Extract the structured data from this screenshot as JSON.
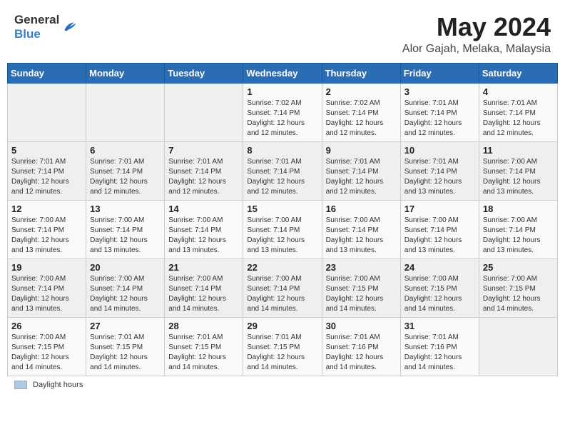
{
  "header": {
    "logo_line1": "General",
    "logo_line2": "Blue",
    "title": "May 2024",
    "subtitle": "Alor Gajah, Melaka, Malaysia"
  },
  "days_of_week": [
    "Sunday",
    "Monday",
    "Tuesday",
    "Wednesday",
    "Thursday",
    "Friday",
    "Saturday"
  ],
  "weeks": [
    {
      "days": [
        {
          "number": "",
          "info": ""
        },
        {
          "number": "",
          "info": ""
        },
        {
          "number": "",
          "info": ""
        },
        {
          "number": "1",
          "info": "Sunrise: 7:02 AM\nSunset: 7:14 PM\nDaylight: 12 hours\nand 12 minutes."
        },
        {
          "number": "2",
          "info": "Sunrise: 7:02 AM\nSunset: 7:14 PM\nDaylight: 12 hours\nand 12 minutes."
        },
        {
          "number": "3",
          "info": "Sunrise: 7:01 AM\nSunset: 7:14 PM\nDaylight: 12 hours\nand 12 minutes."
        },
        {
          "number": "4",
          "info": "Sunrise: 7:01 AM\nSunset: 7:14 PM\nDaylight: 12 hours\nand 12 minutes."
        }
      ]
    },
    {
      "days": [
        {
          "number": "5",
          "info": "Sunrise: 7:01 AM\nSunset: 7:14 PM\nDaylight: 12 hours\nand 12 minutes."
        },
        {
          "number": "6",
          "info": "Sunrise: 7:01 AM\nSunset: 7:14 PM\nDaylight: 12 hours\nand 12 minutes."
        },
        {
          "number": "7",
          "info": "Sunrise: 7:01 AM\nSunset: 7:14 PM\nDaylight: 12 hours\nand 12 minutes."
        },
        {
          "number": "8",
          "info": "Sunrise: 7:01 AM\nSunset: 7:14 PM\nDaylight: 12 hours\nand 12 minutes."
        },
        {
          "number": "9",
          "info": "Sunrise: 7:01 AM\nSunset: 7:14 PM\nDaylight: 12 hours\nand 12 minutes."
        },
        {
          "number": "10",
          "info": "Sunrise: 7:01 AM\nSunset: 7:14 PM\nDaylight: 12 hours\nand 13 minutes."
        },
        {
          "number": "11",
          "info": "Sunrise: 7:00 AM\nSunset: 7:14 PM\nDaylight: 12 hours\nand 13 minutes."
        }
      ]
    },
    {
      "days": [
        {
          "number": "12",
          "info": "Sunrise: 7:00 AM\nSunset: 7:14 PM\nDaylight: 12 hours\nand 13 minutes."
        },
        {
          "number": "13",
          "info": "Sunrise: 7:00 AM\nSunset: 7:14 PM\nDaylight: 12 hours\nand 13 minutes."
        },
        {
          "number": "14",
          "info": "Sunrise: 7:00 AM\nSunset: 7:14 PM\nDaylight: 12 hours\nand 13 minutes."
        },
        {
          "number": "15",
          "info": "Sunrise: 7:00 AM\nSunset: 7:14 PM\nDaylight: 12 hours\nand 13 minutes."
        },
        {
          "number": "16",
          "info": "Sunrise: 7:00 AM\nSunset: 7:14 PM\nDaylight: 12 hours\nand 13 minutes."
        },
        {
          "number": "17",
          "info": "Sunrise: 7:00 AM\nSunset: 7:14 PM\nDaylight: 12 hours\nand 13 minutes."
        },
        {
          "number": "18",
          "info": "Sunrise: 7:00 AM\nSunset: 7:14 PM\nDaylight: 12 hours\nand 13 minutes."
        }
      ]
    },
    {
      "days": [
        {
          "number": "19",
          "info": "Sunrise: 7:00 AM\nSunset: 7:14 PM\nDaylight: 12 hours\nand 13 minutes."
        },
        {
          "number": "20",
          "info": "Sunrise: 7:00 AM\nSunset: 7:14 PM\nDaylight: 12 hours\nand 14 minutes."
        },
        {
          "number": "21",
          "info": "Sunrise: 7:00 AM\nSunset: 7:14 PM\nDaylight: 12 hours\nand 14 minutes."
        },
        {
          "number": "22",
          "info": "Sunrise: 7:00 AM\nSunset: 7:14 PM\nDaylight: 12 hours\nand 14 minutes."
        },
        {
          "number": "23",
          "info": "Sunrise: 7:00 AM\nSunset: 7:15 PM\nDaylight: 12 hours\nand 14 minutes."
        },
        {
          "number": "24",
          "info": "Sunrise: 7:00 AM\nSunset: 7:15 PM\nDaylight: 12 hours\nand 14 minutes."
        },
        {
          "number": "25",
          "info": "Sunrise: 7:00 AM\nSunset: 7:15 PM\nDaylight: 12 hours\nand 14 minutes."
        }
      ]
    },
    {
      "days": [
        {
          "number": "26",
          "info": "Sunrise: 7:00 AM\nSunset: 7:15 PM\nDaylight: 12 hours\nand 14 minutes."
        },
        {
          "number": "27",
          "info": "Sunrise: 7:01 AM\nSunset: 7:15 PM\nDaylight: 12 hours\nand 14 minutes."
        },
        {
          "number": "28",
          "info": "Sunrise: 7:01 AM\nSunset: 7:15 PM\nDaylight: 12 hours\nand 14 minutes."
        },
        {
          "number": "29",
          "info": "Sunrise: 7:01 AM\nSunset: 7:15 PM\nDaylight: 12 hours\nand 14 minutes."
        },
        {
          "number": "30",
          "info": "Sunrise: 7:01 AM\nSunset: 7:16 PM\nDaylight: 12 hours\nand 14 minutes."
        },
        {
          "number": "31",
          "info": "Sunrise: 7:01 AM\nSunset: 7:16 PM\nDaylight: 12 hours\nand 14 minutes."
        },
        {
          "number": "",
          "info": ""
        }
      ]
    }
  ],
  "legend": {
    "daylight_label": "Daylight hours"
  }
}
